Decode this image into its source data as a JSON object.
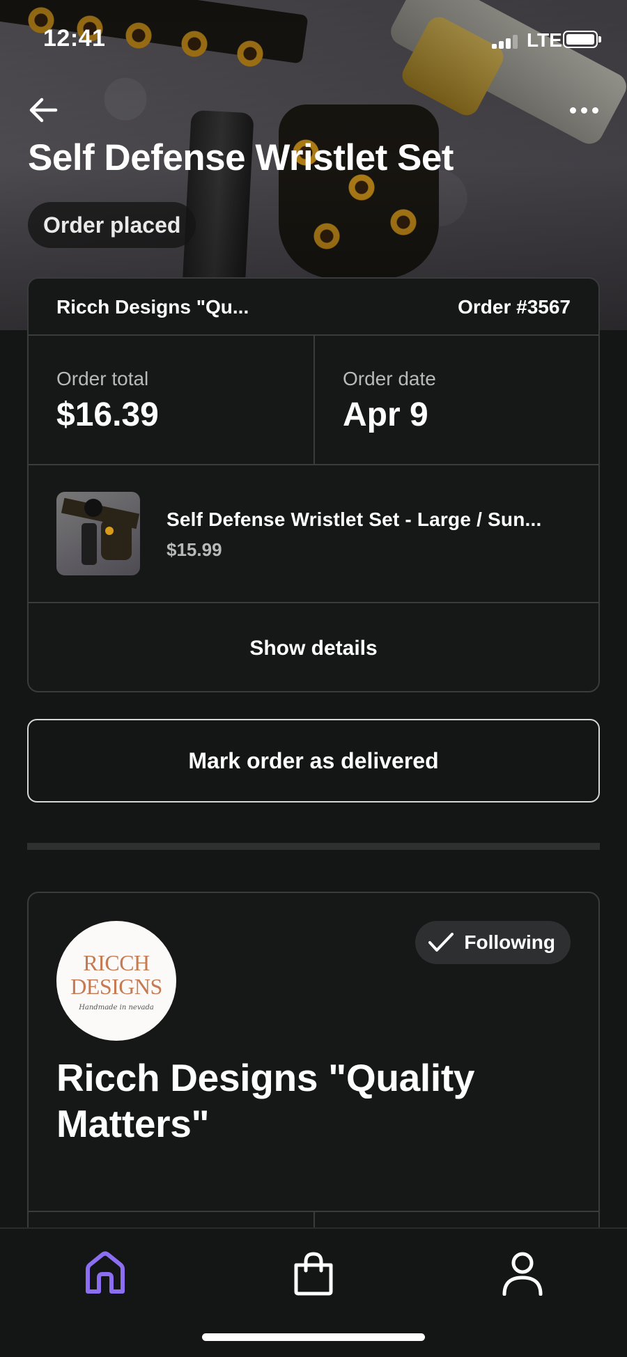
{
  "status_bar": {
    "time": "12:41",
    "network": "LTE"
  },
  "header": {
    "title": "Self Defense Wristlet Set",
    "status": "Order placed"
  },
  "order": {
    "seller_truncated": "Ricch Designs \"Qu...",
    "order_number": "Order #3567",
    "total_label": "Order total",
    "total_value": "$16.39",
    "date_label": "Order date",
    "date_value": "Apr 9",
    "item": {
      "name": "Self Defense Wristlet Set - Large / Sun...",
      "price": "$15.99"
    },
    "details_label": "Show details"
  },
  "actions": {
    "mark_delivered": "Mark order as delivered"
  },
  "shop": {
    "logo_line1": "RICCH",
    "logo_line2": "DESIGNS",
    "logo_sub": "Handmade in nevada",
    "follow_label": "Following",
    "name": "Ricch Designs \"Quality Matters\""
  },
  "colors": {
    "background": "#141515",
    "card_border": "#3a3b3c",
    "accent_home": "#8c6ff0",
    "muted_text": "#b9b9b9",
    "logo_text": "#c67a52"
  },
  "icons": {
    "back": "arrow-left-icon",
    "more": "ellipsis-icon",
    "check": "check-icon",
    "home": "home-icon",
    "orders": "shopping-bag-icon",
    "profile": "person-icon"
  }
}
